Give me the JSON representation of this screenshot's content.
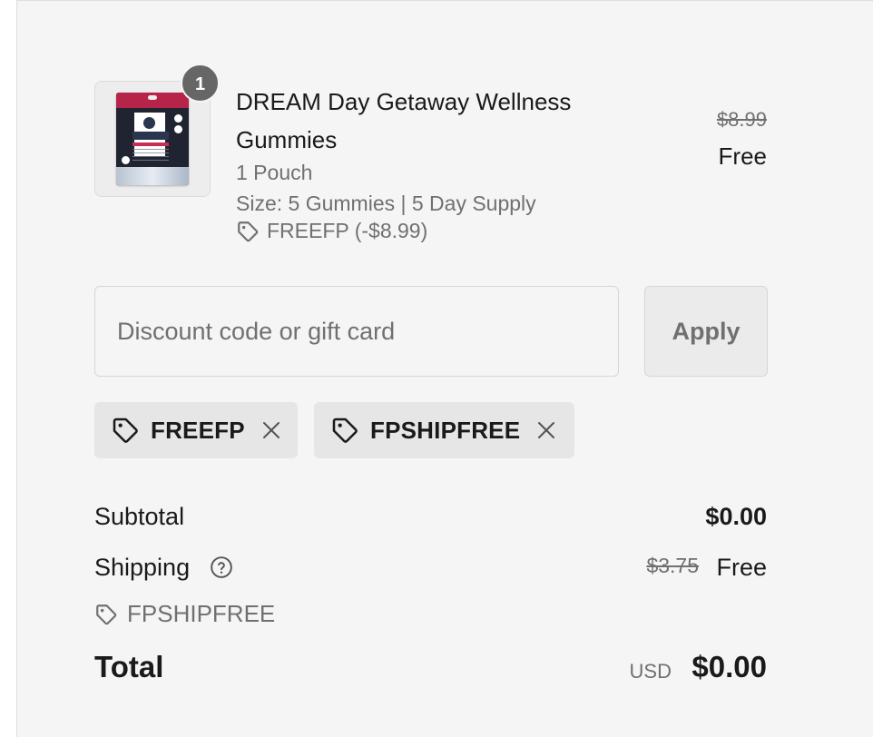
{
  "colors": {
    "panel_background": "#f5f5f5",
    "badge_background": "#666666",
    "muted_text": "#707070",
    "primary_text": "#1a1a1a",
    "chip_background": "#e6e6e6"
  },
  "product": {
    "quantity_badge": "1",
    "title": "DREAM Day Getaway Wellness Gummies",
    "variant": "1 Pouch",
    "size": "Size: 5 Gummies | 5 Day Supply",
    "discount": "FREEFP (-$8.99)",
    "original_price": "$8.99",
    "price": "Free",
    "image_icon": "gummies-pouch-image"
  },
  "discount_form": {
    "placeholder": "Discount code or gift card",
    "value": "",
    "apply_label": "Apply"
  },
  "applied_codes": [
    {
      "code": "FREEFP",
      "icon": "tag-icon",
      "remove_icon": "close-icon"
    },
    {
      "code": "FPSHIPFREE",
      "icon": "tag-icon",
      "remove_icon": "close-icon"
    }
  ],
  "summary": {
    "subtotal_label": "Subtotal",
    "subtotal_value": "$0.00",
    "shipping_label": "Shipping",
    "shipping_help_icon": "help-circle-icon",
    "shipping_original": "$3.75",
    "shipping_value": "Free",
    "shipping_discount": "FPSHIPFREE",
    "total_label": "Total",
    "currency": "USD",
    "total_value": "$0.00"
  }
}
